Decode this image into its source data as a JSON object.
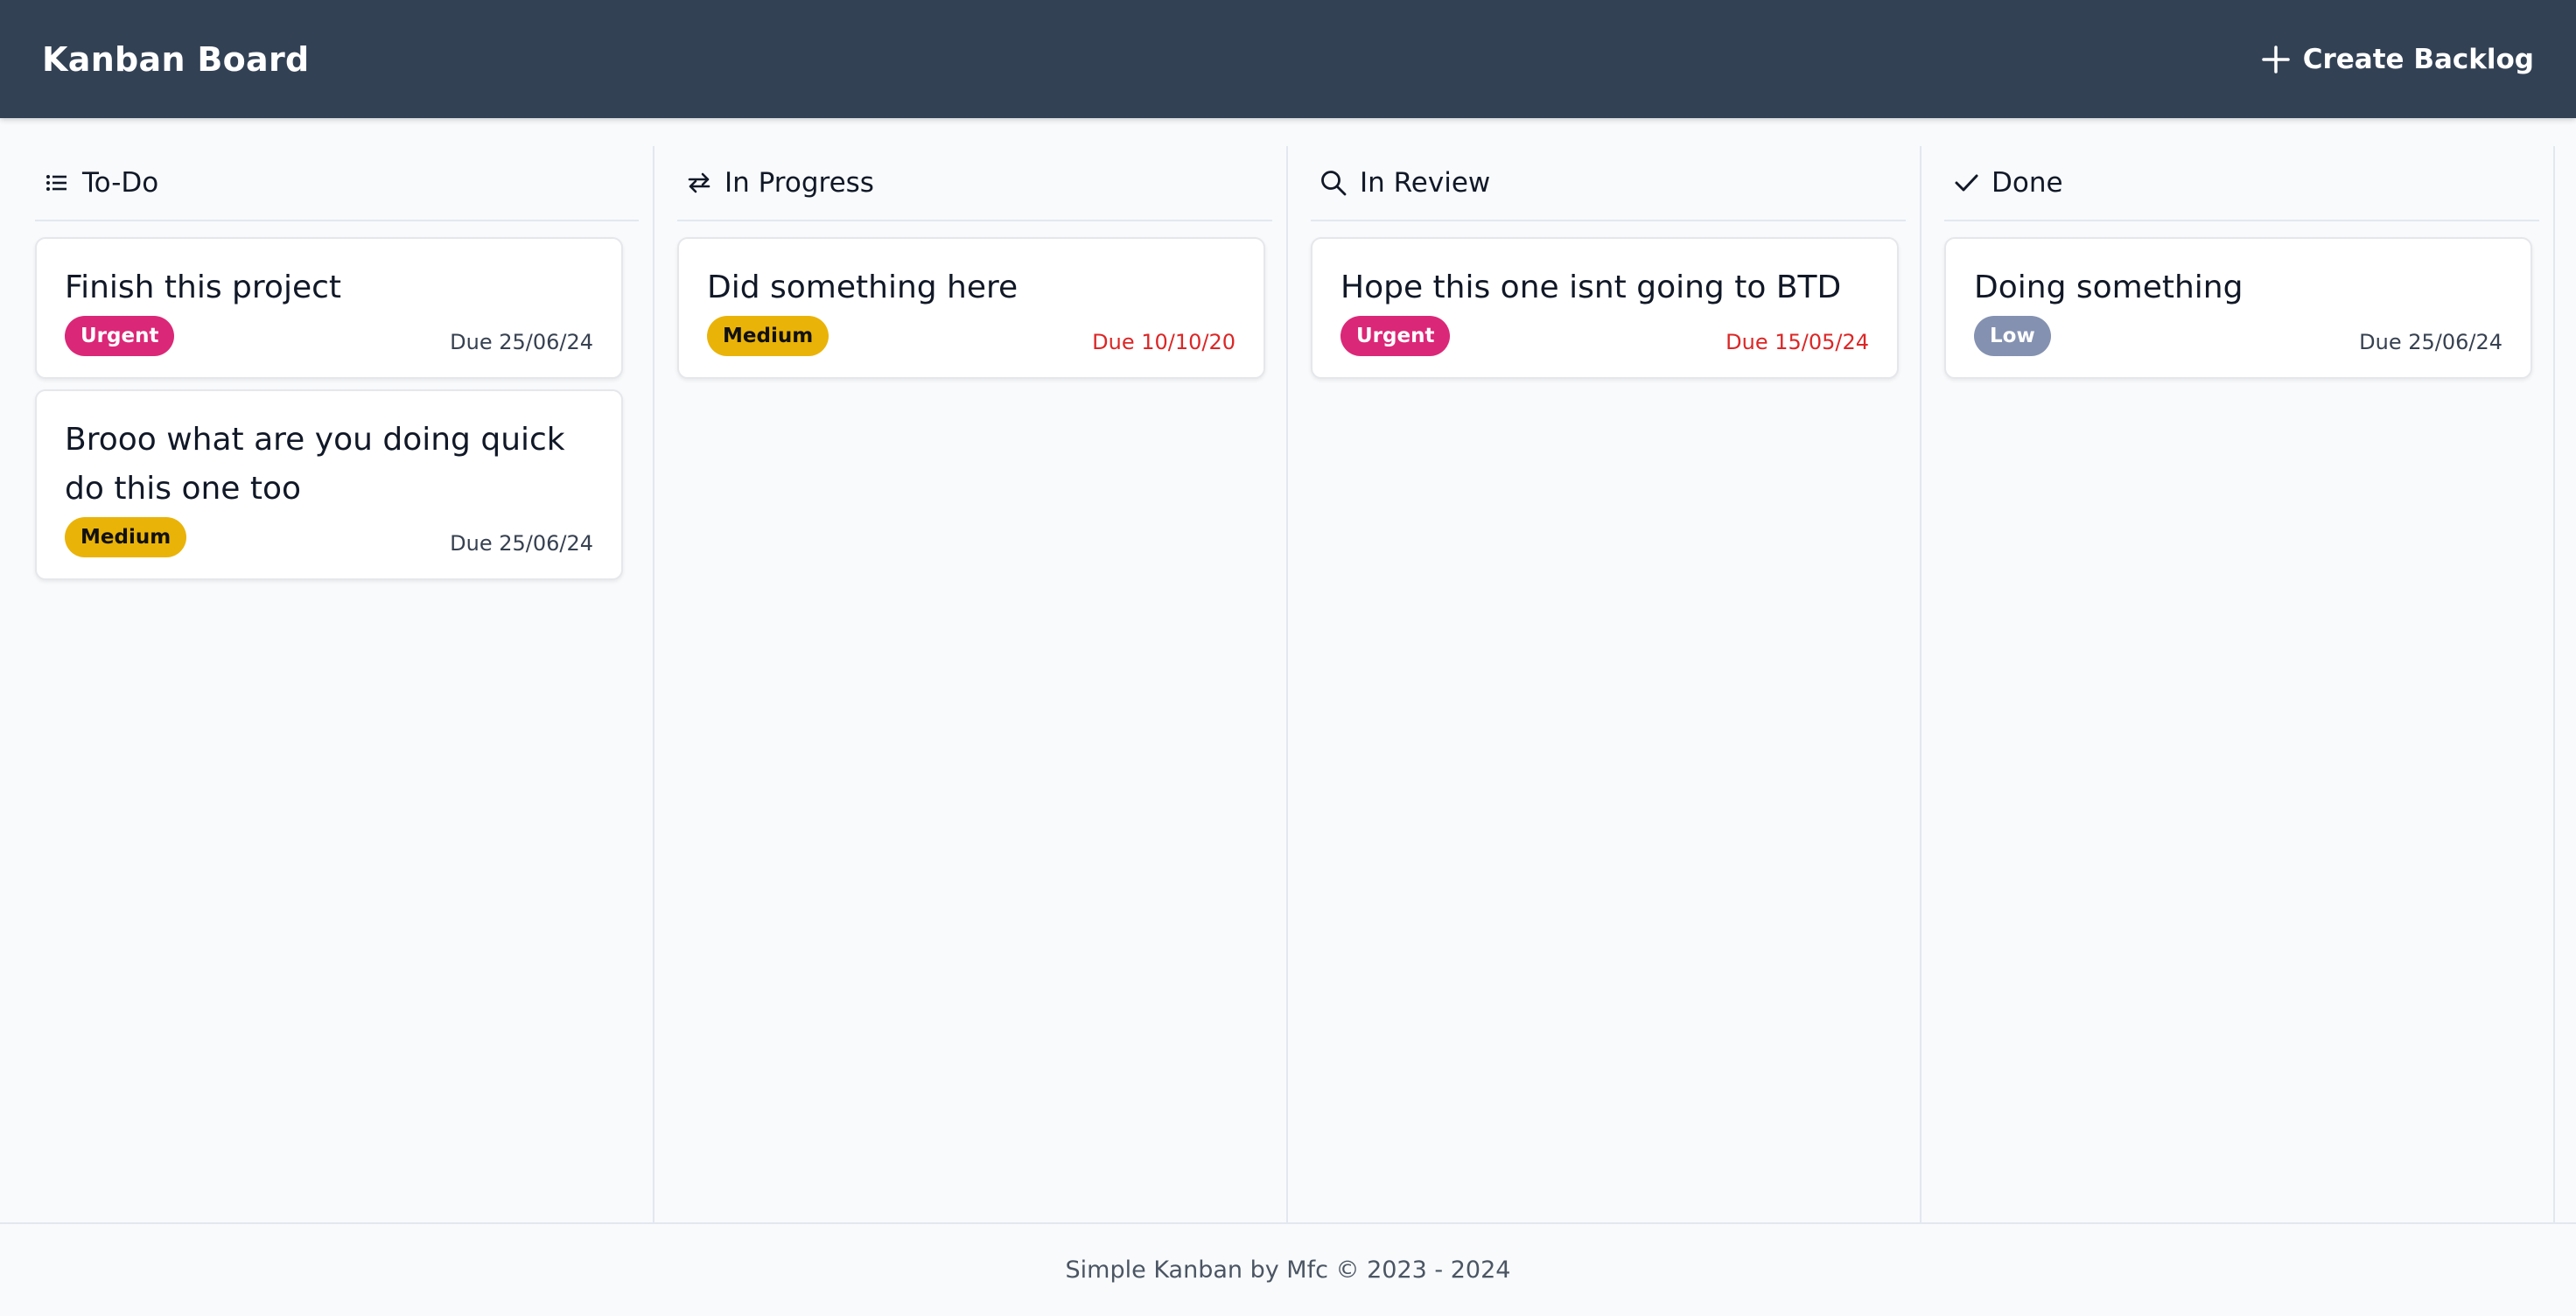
{
  "header": {
    "title": "Kanban Board",
    "create_label": "Create Backlog"
  },
  "columns": [
    {
      "title": "To-Do",
      "icon": "list-icon",
      "cards": [
        {
          "title": "Finish this project",
          "priority": "Urgent",
          "due": "Due 25/06/24",
          "overdue": false
        },
        {
          "title": "Brooo what are you doing quick do this one too",
          "priority": "Medium",
          "due": "Due 25/06/24",
          "overdue": false
        }
      ]
    },
    {
      "title": "In Progress",
      "icon": "arrows-swap-icon",
      "cards": [
        {
          "title": "Did something here",
          "priority": "Medium",
          "due": "Due 10/10/20",
          "overdue": true
        }
      ]
    },
    {
      "title": "In Review",
      "icon": "search-icon",
      "cards": [
        {
          "title": "Hope this one isnt going to BTD",
          "priority": "Urgent",
          "due": "Due 15/05/24",
          "overdue": true
        }
      ]
    },
    {
      "title": "Done",
      "icon": "check-icon",
      "cards": [
        {
          "title": "Doing something",
          "priority": "Low",
          "due": "Due 25/06/24",
          "overdue": false
        }
      ]
    }
  ],
  "footer": {
    "text": "Simple Kanban by Mfc © 2023 - 2024"
  },
  "colors": {
    "header_bg": "#334155",
    "urgent": "#db2777",
    "medium": "#eab308",
    "low": "#8491b1",
    "overdue_text": "#dc2626"
  }
}
